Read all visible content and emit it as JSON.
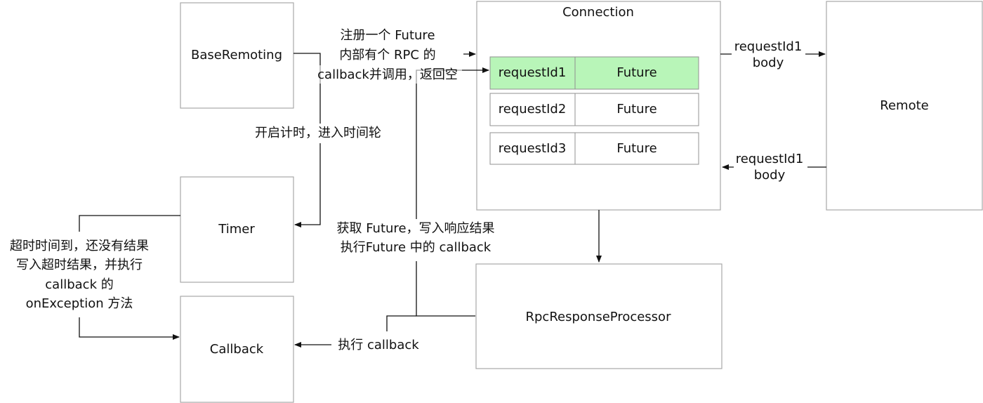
{
  "nodes": {
    "base_remoting": "BaseRemoting",
    "timer": "Timer",
    "callback": "Callback",
    "connection": "Connection",
    "remote": "Remote",
    "rpc_response_processor": "RpcResponseProcessor"
  },
  "connection_table": [
    {
      "id": "requestId1",
      "value": "Future",
      "highlighted": true
    },
    {
      "id": "requestId2",
      "value": "Future",
      "highlighted": false
    },
    {
      "id": "requestId3",
      "value": "Future",
      "highlighted": false
    }
  ],
  "edge_labels": {
    "register": [
      "注册一个 Future",
      "内部有个 RPC 的",
      "callback并调用，返回空"
    ],
    "start_timer": "开启计时，进入时间轮",
    "timeout": [
      "超时时间到，还没有结果",
      "写入超时结果，并执行",
      "callback 的",
      "onException 方法"
    ],
    "get_future": [
      "获取 Future，写入响应结果",
      "执行Future 中的 callback"
    ],
    "exec_callback": "执行 callback",
    "request": [
      "requestId1",
      "body"
    ],
    "response": [
      "requestId1",
      "body"
    ]
  },
  "colors": {
    "highlight": "#b8f5b8",
    "border": "#a8a8a8",
    "line": "#111111"
  }
}
